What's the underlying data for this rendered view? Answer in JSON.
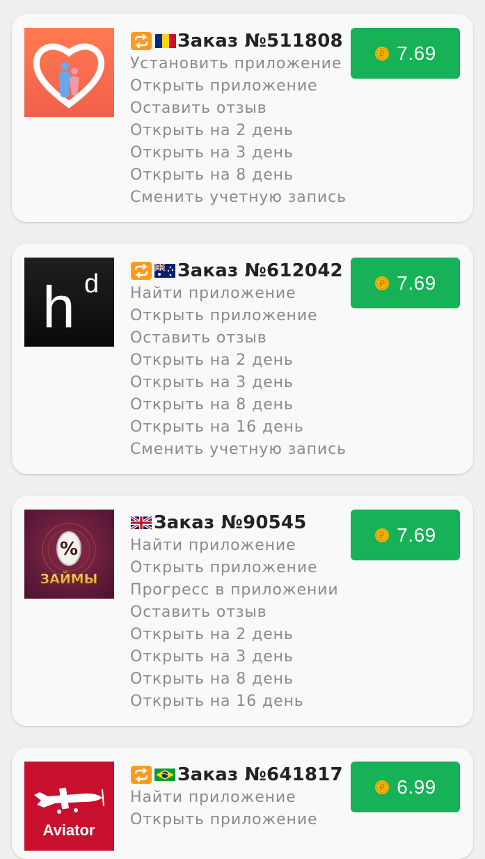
{
  "orders": [
    {
      "title": "Заказ №511808",
      "flag": "romania-flag",
      "has_repeat": true,
      "price": "7.69",
      "app_icon": "family-heart-icon",
      "tasks": [
        "Установить приложение",
        "Открыть приложение",
        "Оставить отзыв",
        "Открыть на 2 день",
        "Открыть на 3 день",
        "Открыть на 8 день",
        "Сменить учетную запись"
      ]
    },
    {
      "title": "Заказ №612042",
      "flag": "australia-flag",
      "has_repeat": true,
      "price": "7.69",
      "app_icon": "hd-logo-icon",
      "icon_text": "h",
      "icon_sup": "d",
      "tasks": [
        "Найти приложение",
        "Открыть приложение",
        "Оставить отзыв",
        "Открыть на 2 день",
        "Открыть на 3 день",
        "Открыть на 8 день",
        "Открыть на 16 день",
        "Сменить учетную запись"
      ]
    },
    {
      "title": "Заказ №90545",
      "flag": "uk-flag",
      "has_repeat": false,
      "price": "7.69",
      "app_icon": "loans-percent-icon",
      "icon_text": "ЗАЙМЫ",
      "tasks": [
        "Найти приложение",
        "Открыть приложение",
        "Прогресс в приложении",
        "Оставить отзыв",
        "Открыть на 2 день",
        "Открыть на 3 день",
        "Открыть на 8 день",
        "Открыть на 16 день"
      ]
    },
    {
      "title": "Заказ №641817",
      "flag": "brazil-flag",
      "has_repeat": true,
      "price": "6.99",
      "app_icon": "aviator-plane-icon",
      "icon_text": "Aviator",
      "tasks": [
        "Найти приложение",
        "Открыть приложение"
      ]
    }
  ],
  "colors": {
    "button_green": "#17b157",
    "card_bg": "#f9f9f9",
    "page_bg": "#efefef",
    "task_text": "#8a8a8a",
    "coin": "#f5b400"
  }
}
